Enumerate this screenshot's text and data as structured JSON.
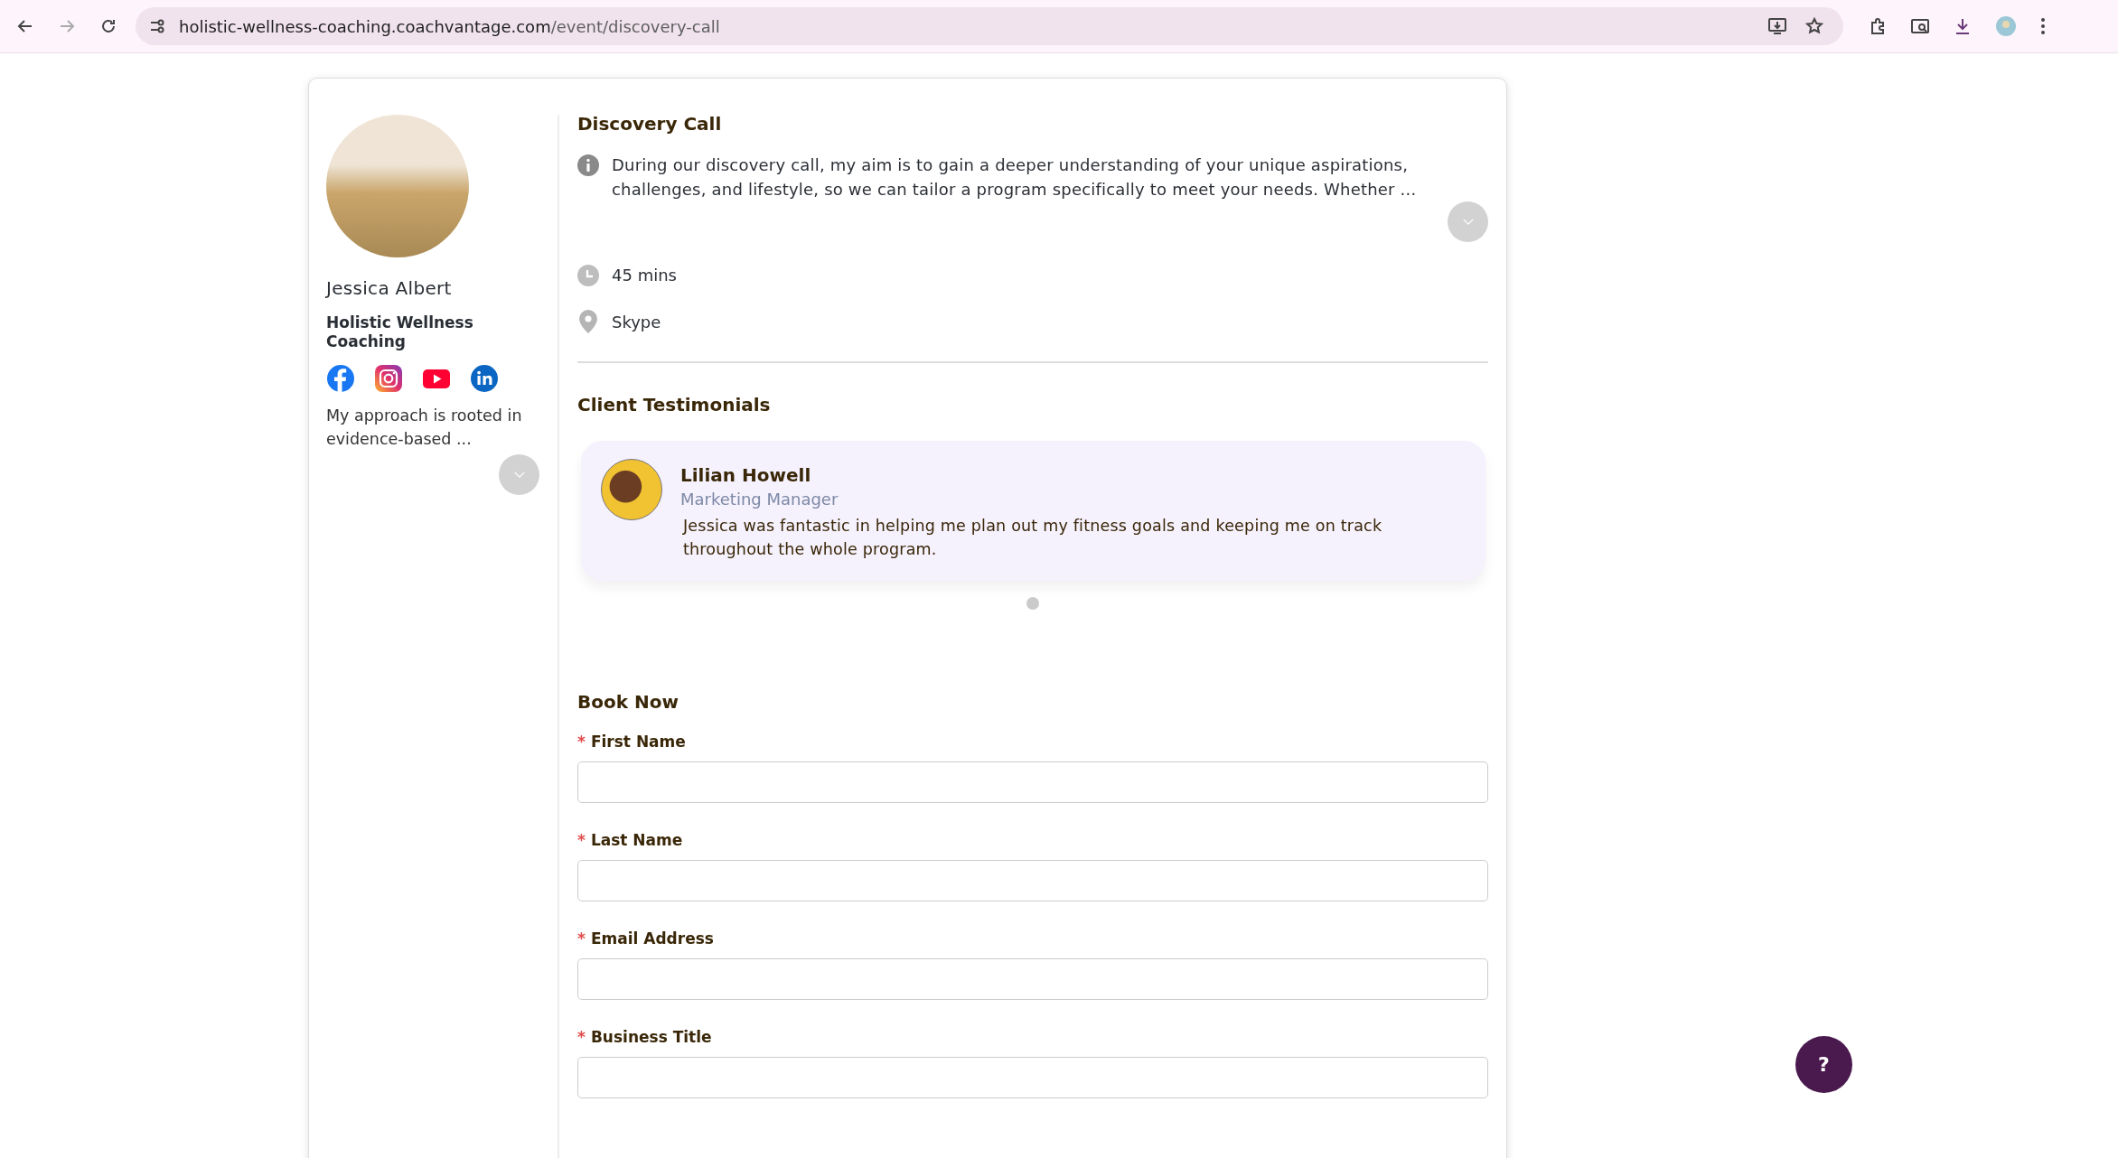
{
  "browser": {
    "url_host": "holistic-wellness-coaching.coachvantage.com",
    "url_path": "/event/discovery-call"
  },
  "profile": {
    "name": "Jessica Albert",
    "business": "Holistic Wellness Coaching",
    "bio": "My approach is rooted in evidence-based ...",
    "socials": [
      {
        "kind": "facebook"
      },
      {
        "kind": "instagram"
      },
      {
        "kind": "youtube"
      },
      {
        "kind": "linkedin"
      }
    ]
  },
  "event": {
    "title": "Discovery Call",
    "description": "During our discovery call, my aim is to gain a deeper understanding of your unique aspirations, challenges, and lifestyle, so we can tailor a program specifically to meet your needs. Whether ...",
    "duration": "45 mins",
    "location": "Skype"
  },
  "testimonials_section": {
    "title": "Client Testimonials",
    "items": [
      {
        "name": "Lilian Howell",
        "role": "Marketing Manager",
        "quote": "Jessica was fantastic in helping me plan out my fitness goals and keeping me on track throughout the whole program.",
        "selected": true
      }
    ]
  },
  "booking": {
    "title": "Book Now",
    "fields": [
      {
        "label": "First Name",
        "marker": "*"
      },
      {
        "label": "Last Name",
        "marker": "*"
      },
      {
        "label": "Email Address",
        "marker": "*"
      },
      {
        "label": "Business Title",
        "marker": "*"
      }
    ]
  },
  "help_button": {
    "label": "?"
  }
}
